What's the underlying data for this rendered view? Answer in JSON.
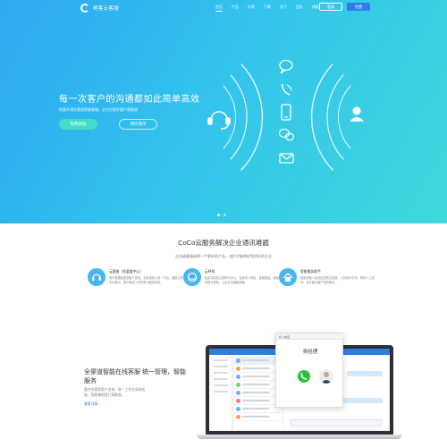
{
  "nav": {
    "brand": "柯客云客服",
    "menu": [
      "首页",
      "产品",
      "价格",
      "下载",
      "关于",
      "团队",
      "博客"
    ],
    "login_label": "登录",
    "register_label": "免费"
  },
  "hero": {
    "title": "每一次客户的沟通都如此简单高效",
    "subtitle": "快速开通全渠道智能客服，全方位提升客户满意度",
    "primary_button": "免费体验",
    "secondary_button": "预约演示",
    "slide_count": 2,
    "active_slide": 1
  },
  "services": {
    "title": "CoCo云服务解决企业通讯难题",
    "subtitle": "企业级客服选择一个更好的产品，也们才能带好您的好的企业",
    "cards": [
      {
        "name": "云客服（多渠道中心）",
        "desc": "集中管理各渠道客户咨询，多渠道接入统一平台，数据分析实时展示，提升客服工作效率与服务质量。",
        "color": "#4ab6ef"
      },
      {
        "name": "云呼叫",
        "desc": "稳定高效的云端呼叫中心，支持呼入呼出、智能路由、通话录音与质检，让企业沟通更顺畅。",
        "color": "#4ab6ef"
      },
      {
        "name": "智能服务助手",
        "desc": "智能机器人自动应答常见问题，人机协作分流，降低人工成本，全天候为客户提供服务。",
        "color": "#4ab6ef"
      }
    ]
  },
  "feature": {
    "title": "全渠道智能在线客服 统一管理，智能服务",
    "desc": "整合各渠道客户咨询，统一工作台高效处理，智能辅助提升满意度。",
    "link": "查看详情",
    "call_name": "吴经理",
    "call_label": "呼入电话"
  },
  "colors": {
    "hero_start": "#2ea8f2",
    "hero_end": "#3fd8dc",
    "accent": "#2e7de0",
    "call_green": "#2bc03b"
  }
}
